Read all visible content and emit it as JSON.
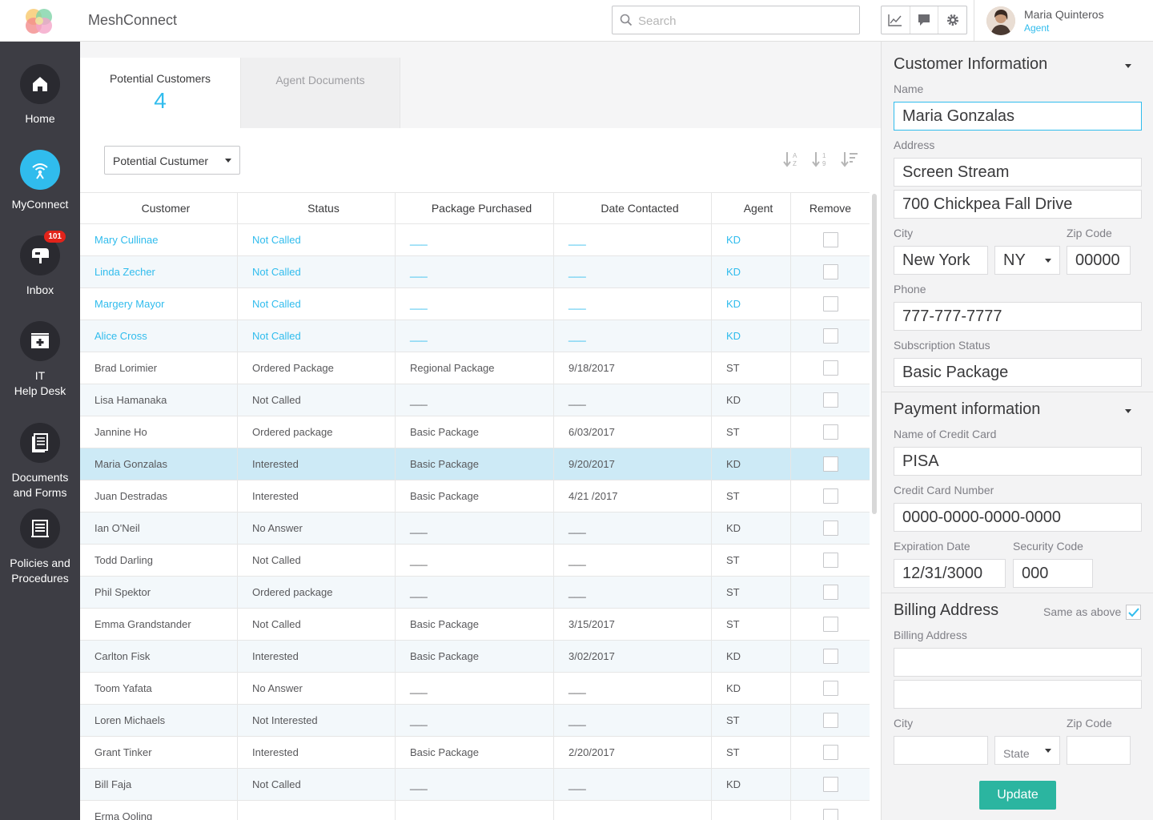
{
  "app": {
    "title": "MeshConnect"
  },
  "search": {
    "placeholder": "Search"
  },
  "user": {
    "name": "Maria Quinteros",
    "role": "Agent"
  },
  "nav": [
    {
      "label": "Home",
      "icon": "home-icon"
    },
    {
      "label": "MyConnect",
      "icon": "wifi-broadcast-icon"
    },
    {
      "label": "Inbox",
      "icon": "mailbox-icon",
      "badge": "101"
    },
    {
      "label": "IT\nHelp Desk",
      "icon": "first-aid-kit-icon"
    },
    {
      "label": "Documents\nand Forms",
      "icon": "document-icon"
    },
    {
      "label": "Policies and\nProcedures",
      "icon": "list-icon"
    }
  ],
  "tabs": [
    {
      "label": "Potential Customers",
      "count": "4"
    },
    {
      "label": "Agent Documents"
    }
  ],
  "filter": {
    "selected": "Potential Custumer"
  },
  "table": {
    "columns": [
      "Customer",
      "Status",
      "Package Purchased",
      "Date Contacted",
      "Agent",
      "Remove"
    ],
    "rows": [
      {
        "customer": "Mary Cullinae",
        "status": "Not Called",
        "package": "___",
        "date": "___",
        "agent": "KD",
        "link": true
      },
      {
        "customer": "Linda Zecher",
        "status": "Not Called",
        "package": "___",
        "date": "___",
        "agent": "KD",
        "link": true
      },
      {
        "customer": "Margery Mayor",
        "status": "Not Called",
        "package": "___",
        "date": "___",
        "agent": "KD",
        "link": true
      },
      {
        "customer": "Alice Cross",
        "status": "Not Called",
        "package": "___",
        "date": "___",
        "agent": "KD",
        "link": true
      },
      {
        "customer": "Brad Lorimier",
        "status": "Ordered Package",
        "package": "Regional Package",
        "date": "9/18/2017",
        "agent": "ST"
      },
      {
        "customer": "Lisa Hamanaka",
        "status": "Not Called",
        "package": "___",
        "date": "___",
        "agent": "KD"
      },
      {
        "customer": "Jannine Ho",
        "status": "Ordered package",
        "package": "Basic Package",
        "date": "6/03/2017",
        "agent": "ST"
      },
      {
        "customer": "Maria Gonzalas",
        "status": "Interested",
        "package": "Basic Package",
        "date": "9/20/2017",
        "agent": "KD",
        "selected": true
      },
      {
        "customer": "Juan Destradas",
        "status": "Interested",
        "package": "Basic Package",
        "date": "4/21 /2017",
        "agent": "ST"
      },
      {
        "customer": "Ian O'Neil",
        "status": "No Answer",
        "package": "___",
        "date": "___",
        "agent": "KD"
      },
      {
        "customer": "Todd Darling",
        "status": "Not Called",
        "package": "___",
        "date": "___",
        "agent": "ST"
      },
      {
        "customer": "Phil Spektor",
        "status": "Ordered package",
        "package": "___",
        "date": "___",
        "agent": "ST"
      },
      {
        "customer": "Emma Grandstander",
        "status": "Not Called",
        "package": "Basic Package",
        "date": "3/15/2017",
        "agent": "ST"
      },
      {
        "customer": "Carlton Fisk",
        "status": "Interested",
        "package": "Basic Package",
        "date": "3/02/2017",
        "agent": "KD"
      },
      {
        "customer": "Toom Yafata",
        "status": "No Answer",
        "package": "___",
        "date": "___",
        "agent": "KD"
      },
      {
        "customer": "Loren Michaels",
        "status": "Not Interested",
        "package": "___",
        "date": "___",
        "agent": "ST"
      },
      {
        "customer": "Grant Tinker",
        "status": "Interested",
        "package": "Basic Package",
        "date": "2/20/2017",
        "agent": "ST"
      },
      {
        "customer": "Bill Faja",
        "status": "Not Called",
        "package": "___",
        "date": "___",
        "agent": "KD"
      },
      {
        "customer": "Erma Ooling",
        "status": "",
        "package": "",
        "date": "",
        "agent": ""
      }
    ]
  },
  "customer_info": {
    "title": "Customer Information",
    "name_label": "Name",
    "name": "Maria Gonzalas",
    "address_label": "Address",
    "address1": "Screen Stream",
    "address2": "700 Chickpea Fall Drive",
    "city_label": "City",
    "city": "New York",
    "state": "NY",
    "zip_label": "Zip Code",
    "zip": "00000",
    "phone_label": "Phone",
    "phone": "777-777-7777",
    "subscription_label": "Subscription Status",
    "subscription": "Basic Package"
  },
  "payment_info": {
    "title": "Payment information",
    "card_name_label": "Name of Credit Card",
    "card_name": "PISA",
    "card_number_label": "Credit Card Number",
    "card_number": "0000-0000-0000-0000",
    "expiration_label": "Expiration Date",
    "expiration": "12/31/3000",
    "security_label": "Security Code",
    "security": "000"
  },
  "billing": {
    "title": "Billing Address",
    "same_label": "Same as above",
    "same_checked": true,
    "address_label": "Billing Address",
    "city_label": "City",
    "zip_label": "Zip Code",
    "state_placeholder": "State",
    "update_label": "Update"
  },
  "colors": {
    "accent": "#30bced",
    "sidebar": "#3d3d44",
    "update_button": "#2bb5a0",
    "badge": "#e2231a"
  }
}
